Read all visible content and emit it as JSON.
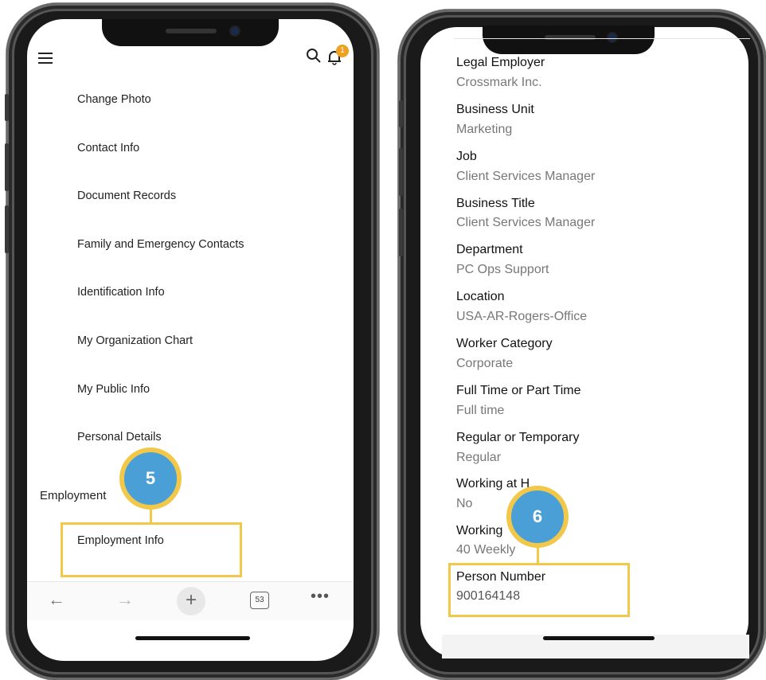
{
  "left": {
    "menu_items": [
      "Change Photo",
      "Contact Info",
      "Document Records",
      "Family and Emergency Contacts",
      "Identification Info",
      "My Organization Chart",
      "My Public Info",
      "Personal Details"
    ],
    "section": "Employment",
    "employment_item": "Employment Info",
    "notification_count": "1",
    "tab_count": "53",
    "callout": "5"
  },
  "right": {
    "fields": [
      {
        "label": "Legal Employer",
        "value": "Crossmark Inc."
      },
      {
        "label": "Business Unit",
        "value": "Marketing"
      },
      {
        "label": "Job",
        "value": "Client Services Manager"
      },
      {
        "label": "Business Title",
        "value": "Client Services Manager"
      },
      {
        "label": "Department",
        "value": "PC Ops Support"
      },
      {
        "label": "Location",
        "value": "USA-AR-Rogers-Office"
      },
      {
        "label": "Worker Category",
        "value": "Corporate"
      },
      {
        "label": "Full Time or Part Time",
        "value": "Full time"
      },
      {
        "label": "Regular or Temporary",
        "value": "Regular"
      },
      {
        "label": "Working at H",
        "value": "No"
      },
      {
        "label": "Working",
        "value": "40 Weekly"
      },
      {
        "label": "Person Number",
        "value": "900164148"
      }
    ],
    "callout": "6"
  },
  "colors": {
    "callout_fill": "#4a9fd6",
    "callout_ring": "#f2c84b",
    "badge": "#f0a020"
  }
}
